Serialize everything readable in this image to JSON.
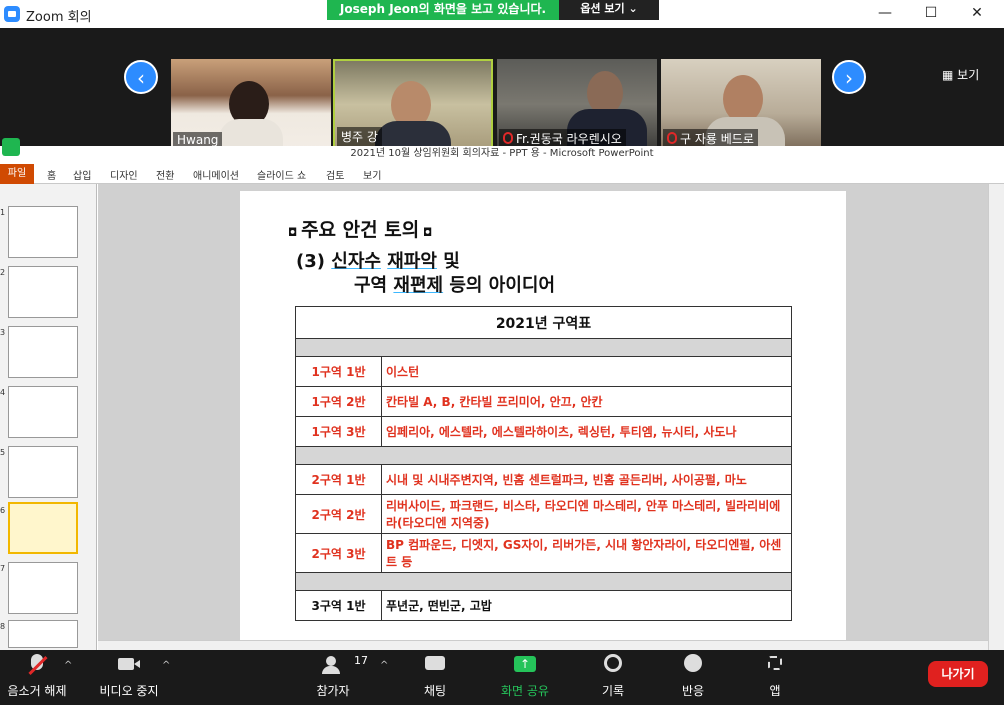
{
  "window": {
    "app_title": "Zoom 회의"
  },
  "share_banner": {
    "text": "Joseph Jeon의 화면을 보고 있습니다.",
    "view_options": "옵션 보기 ⌄"
  },
  "gallery": {
    "view_label": "보기",
    "participants": [
      {
        "name": "Hwang",
        "muted": false
      },
      {
        "name": "병주 강",
        "muted": false
      },
      {
        "name": "Fr.권동국 라우렌시오",
        "muted": true
      },
      {
        "name": "구 자룡 베드로",
        "muted": true
      }
    ]
  },
  "ppt": {
    "title": "2021년 10월 상임위원회 회의자료 - PPT 용 - Microsoft PowerPoint",
    "tabs": [
      "파일",
      "홈",
      "삽입",
      "디자인",
      "전환",
      "애니메이션",
      "슬라이드 쇼",
      "검토",
      "보기"
    ],
    "thumb_numbers": [
      "1",
      "2",
      "3",
      "4",
      "5",
      "6",
      "7",
      "8"
    ],
    "slide": {
      "heading": "주요 안건 토의",
      "sub_prefix": "(3)",
      "sub_w1": "신자수",
      "sub_w2": "재파악",
      "sub_w3": "및",
      "sub2_w1": "구역",
      "sub2_w2": "재편제",
      "sub2_w3": "등의 아이디어",
      "table_title": "2021년 구역표",
      "rows": [
        {
          "c1": "1구역 1반",
          "c2": "이스턴"
        },
        {
          "c1": "1구역 2반",
          "c2": "칸타빌 A, B, 칸타빌 프리미어, 안끄, 안칸"
        },
        {
          "c1": "1구역 3반",
          "c2": "임페리아, 에스텔라, 에스텔라하이츠, 렉싱턴, 투티엠, 뉴시티, 사도나"
        },
        {
          "c1": "2구역 1반",
          "c2": "시내 및 시내주변지역, 빈홈 센트럴파크, 빈홈 골든리버, 사이공펄, 마노"
        },
        {
          "c1": "2구역 2반",
          "c2": "리버사이드, 파크랜드, 비스타, 타오디엔 마스테리, 안푸 마스테리, 빌라리비에라(타오디엔 지역중)"
        },
        {
          "c1": "2구역 3반",
          "c2": "BP 컴파운드, 디엣지, GS자이, 리버가든, 시내 황안자라이, 타오디엔펄, 아센트 등"
        },
        {
          "c1": "3구역 1반",
          "c2": "푸년군, 떤빈군, 고밥"
        }
      ]
    }
  },
  "toolbar": {
    "unmute": "음소거 해제",
    "stop_video": "비디오 중지",
    "participants": "참가자",
    "participant_count": "17",
    "chat": "채팅",
    "share_screen": "화면 공유",
    "record": "기록",
    "reactions": "반응",
    "apps": "앱",
    "leave": "나가기"
  },
  "colors": {
    "zoom_blue": "#2d8cff",
    "share_green": "#1fb650",
    "leave_red": "#e0211f",
    "ppt_file": "#d04a02"
  }
}
